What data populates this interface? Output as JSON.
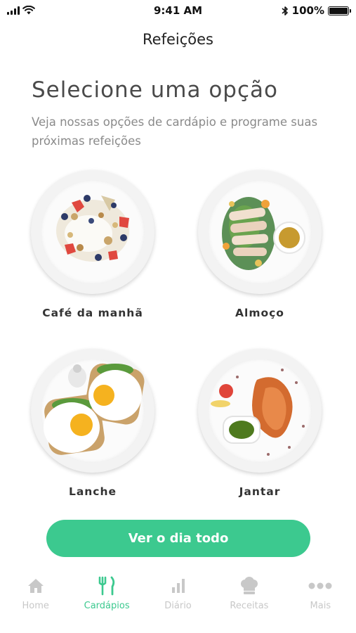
{
  "status": {
    "time": "9:41 AM",
    "battery": "100%",
    "battery_level": 1.0
  },
  "nav": {
    "title": "Refeições"
  },
  "main": {
    "heading": "Selecione uma opção",
    "subtitle": "Veja nossas opções de cardápio e programe suas próximas refeições",
    "meals": [
      {
        "label": "Café da manhã",
        "icon": "breakfast-plate"
      },
      {
        "label": "Almoço",
        "icon": "lunch-plate"
      },
      {
        "label": "Lanche",
        "icon": "snack-plate"
      },
      {
        "label": "Jantar",
        "icon": "dinner-plate"
      }
    ],
    "cta_label": "Ver o dia todo"
  },
  "tabbar": {
    "items": [
      {
        "label": "Home",
        "icon": "home-icon",
        "active": false
      },
      {
        "label": "Cardápios",
        "icon": "fork-knife-icon",
        "active": true
      },
      {
        "label": "Diário",
        "icon": "bar-chart-icon",
        "active": false
      },
      {
        "label": "Receitas",
        "icon": "chef-hat-icon",
        "active": false
      },
      {
        "label": "Mais",
        "icon": "more-icon",
        "active": false
      }
    ]
  },
  "colors": {
    "accent": "#3cc98f",
    "inactive": "#c8c8c8"
  }
}
